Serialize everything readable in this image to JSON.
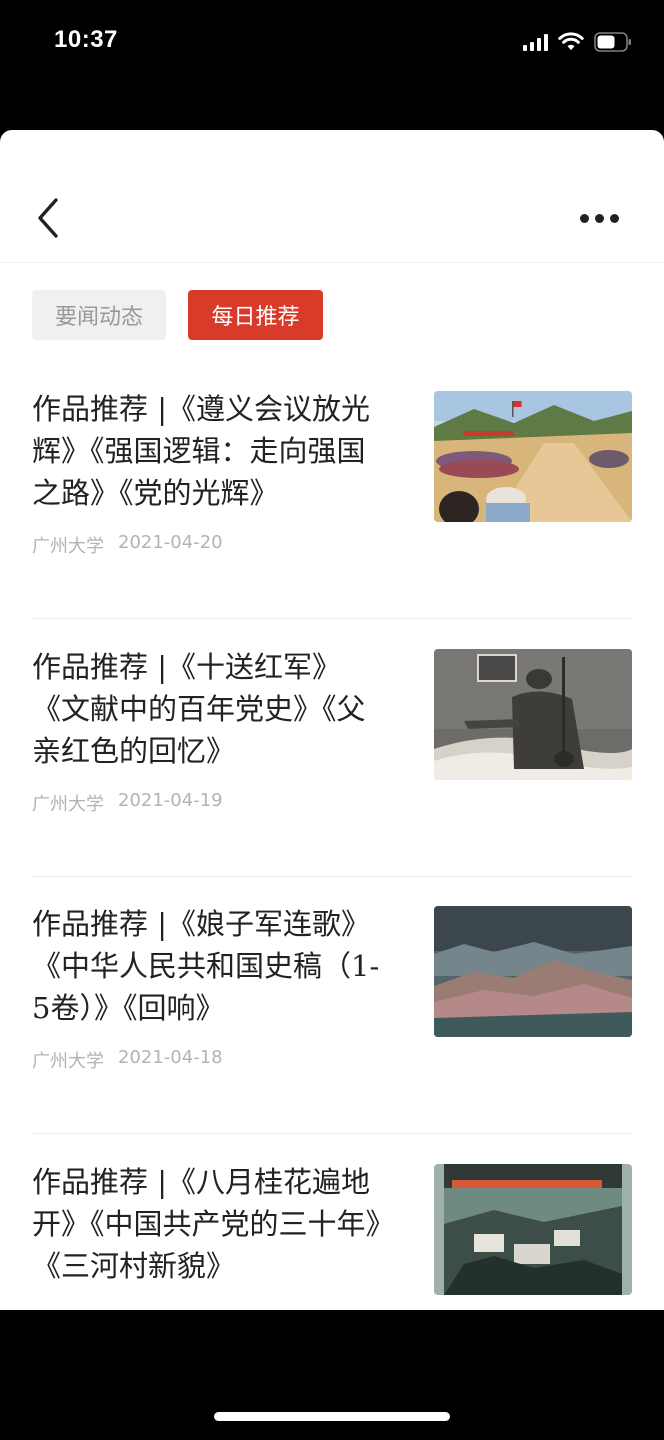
{
  "status_bar": {
    "time": "10:37"
  },
  "tabs": [
    {
      "label": "要闻动态",
      "active": false
    },
    {
      "label": "每日推荐",
      "active": true
    }
  ],
  "articles": [
    {
      "title": "作品推荐 |《遵义会议放光辉》《强国逻辑：走向强国之路》《党的光辉》",
      "source": "广州大学",
      "date": "2021-04-20",
      "thumbnail": "photo-rally-crowd"
    },
    {
      "title": "作品推荐 |《十送红军》《文献中的百年党史》《父亲红色的回忆》",
      "source": "广州大学",
      "date": "2021-04-19",
      "thumbnail": "painting-man-erhu"
    },
    {
      "title": "作品推荐 |《娘子军连歌》《中华人民共和国史稿（1-5卷）》《回响》",
      "source": "广州大学",
      "date": "2021-04-18",
      "thumbnail": "painting-mountains"
    },
    {
      "title": "作品推荐 |《八月桂花遍地开》《中国共产党的三十年》《三河村新貌》",
      "source": "",
      "date": "",
      "thumbnail": "painting-village"
    }
  ],
  "colors": {
    "accent": "#d93b2b",
    "tab_inactive_bg": "#f0f0f0",
    "meta_text": "#b3b3b3"
  }
}
